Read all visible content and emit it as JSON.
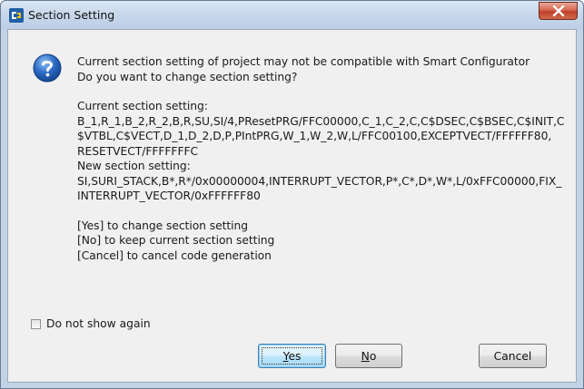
{
  "window": {
    "title": "Section Setting"
  },
  "message": {
    "intro": [
      "Current section setting of project may not be compatible with Smart Configurator",
      "Do you want to change section setting?"
    ],
    "current": [
      "Current section setting:",
      "B_1,R_1,B_2,R_2,B,R,SU,SI/4,PResetPRG/FFC00000,C_1,C_2,C,C$DSEC,C$BSEC,C$INIT,C",
      "$VTBL,C$VECT,D_1,D_2,D,P,PIntPRG,W_1,W_2,W,L/FFC00100,EXCEPTVECT/FFFFFF80,",
      "RESETVECT/FFFFFFFC"
    ],
    "new": [
      "New section setting:",
      "SI,SURI_STACK,B*,R*/0x00000004,INTERRUPT_VECTOR,P*,C*,D*,W*,L/0xFFC00000,FIX_",
      "INTERRUPT_VECTOR/0xFFFFFF80"
    ],
    "options": [
      "[Yes] to change section setting",
      "[No] to keep current section setting",
      "[Cancel] to cancel code generation"
    ]
  },
  "checkbox": {
    "label": "Do not show again",
    "checked": false
  },
  "buttons": {
    "yes": {
      "mnemonic": "Y",
      "rest": "es"
    },
    "no": {
      "mnemonic": "N",
      "rest": "o"
    },
    "cancel": {
      "label": "Cancel"
    }
  },
  "icons": {
    "app": "app-logo-icon",
    "question": "question-icon",
    "close": "close-icon"
  },
  "colors": {
    "title_bar": "#c7d7ea",
    "client_bg": "#f0f0f0",
    "close_button": "#c0402a",
    "question_icon": "#2c6bc4"
  }
}
